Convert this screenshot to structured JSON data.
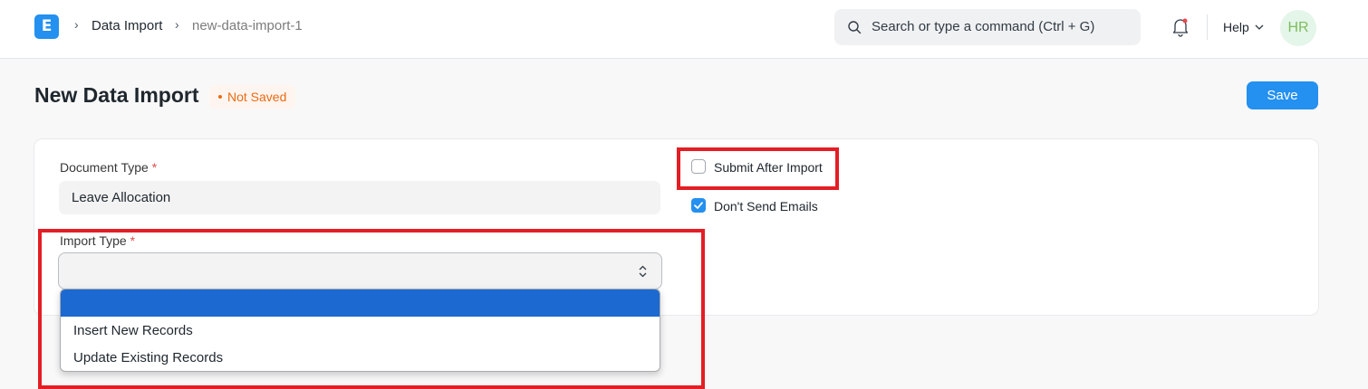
{
  "navbar": {
    "logo_letter": "E",
    "breadcrumbs": [
      "Data Import",
      "new-data-import-1"
    ],
    "search_placeholder": "Search or type a command (Ctrl + G)",
    "help_label": "Help",
    "avatar_initials": "HR"
  },
  "page": {
    "title": "New Data Import",
    "status": "Not Saved",
    "save_label": "Save"
  },
  "form": {
    "document_type": {
      "label": "Document Type",
      "value": "Leave Allocation",
      "required": "*"
    },
    "import_type": {
      "label": "Import Type",
      "value": "",
      "required": "*"
    },
    "submit_after_import": {
      "label": "Submit After Import",
      "checked": false
    },
    "dont_send_emails": {
      "label": "Don't Send Emails",
      "checked": true
    }
  },
  "dropdown": {
    "options": [
      "",
      "Insert New Records",
      "Update Existing Records"
    ],
    "highlighted": ""
  },
  "colors": {
    "accent": "#2490ef",
    "annotation": "#e31e24",
    "status": "#e86c13",
    "highlight": "#1b69d1"
  }
}
